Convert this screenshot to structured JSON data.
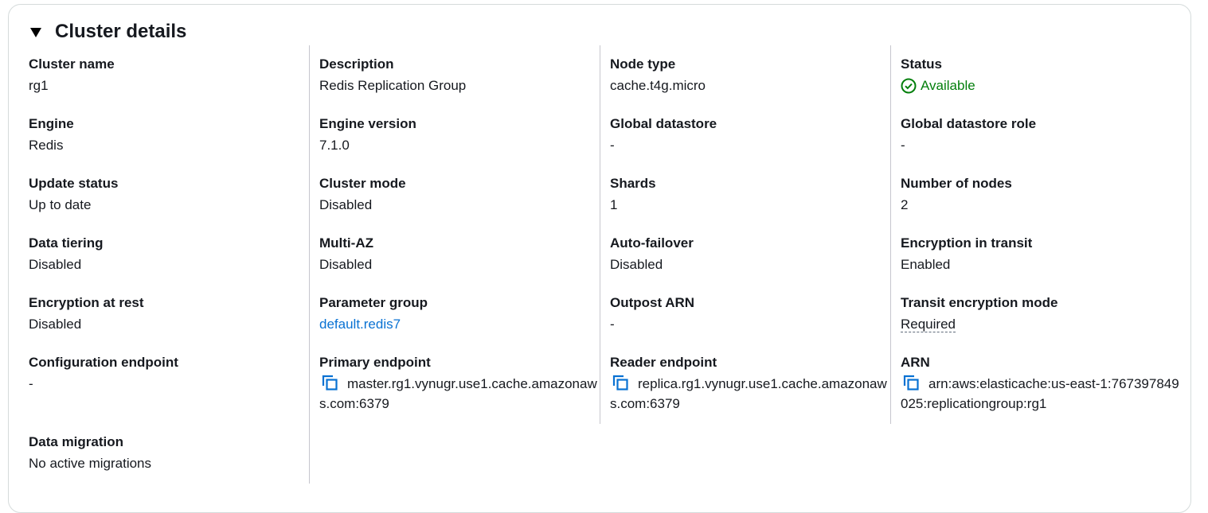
{
  "panel": {
    "title": "Cluster details"
  },
  "columns": [
    {
      "fields": [
        {
          "label": "Cluster name",
          "value": "rg1"
        },
        {
          "label": "Engine",
          "value": "Redis"
        },
        {
          "label": "Update status",
          "value": "Up to date"
        },
        {
          "label": "Data tiering",
          "value": "Disabled"
        },
        {
          "label": "Encryption at rest",
          "value": "Disabled"
        },
        {
          "label": "Configuration endpoint",
          "value": "-"
        },
        {
          "label": "Data migration",
          "value": "No active migrations"
        }
      ]
    },
    {
      "fields": [
        {
          "label": "Description",
          "value": "Redis Replication Group"
        },
        {
          "label": "Engine version",
          "value": "7.1.0"
        },
        {
          "label": "Cluster mode",
          "value": "Disabled"
        },
        {
          "label": "Multi-AZ",
          "value": "Disabled"
        },
        {
          "label": "Parameter group",
          "value": "default.redis7"
        },
        {
          "label": "Primary endpoint",
          "value": "master.rg1.vynugr.use1.cache.amazonaws.com:6379"
        }
      ]
    },
    {
      "fields": [
        {
          "label": "Node type",
          "value": "cache.t4g.micro"
        },
        {
          "label": "Global datastore",
          "value": "-"
        },
        {
          "label": "Shards",
          "value": "1"
        },
        {
          "label": "Auto-failover",
          "value": "Disabled"
        },
        {
          "label": "Outpost ARN",
          "value": "-"
        },
        {
          "label": "Reader endpoint",
          "value": "replica.rg1.vynugr.use1.cache.amazonaws.com:6379"
        }
      ]
    },
    {
      "fields": [
        {
          "label": "Status",
          "value": "Available"
        },
        {
          "label": "Global datastore role",
          "value": "-"
        },
        {
          "label": "Number of nodes",
          "value": "2"
        },
        {
          "label": "Encryption in transit",
          "value": "Enabled"
        },
        {
          "label": "Transit encryption mode",
          "value": "Required"
        },
        {
          "label": "ARN",
          "value": "arn:aws:elasticache:us-east-1:767397849025:replicationgroup:rg1"
        }
      ]
    }
  ],
  "colors": {
    "link": "#0972d3",
    "success": "#037f0c",
    "text": "#16191f",
    "border": "#d5dbdb"
  },
  "icons": {
    "expand": "caret-down-icon",
    "status": "check-circle-icon",
    "copy": "copy-icon"
  }
}
